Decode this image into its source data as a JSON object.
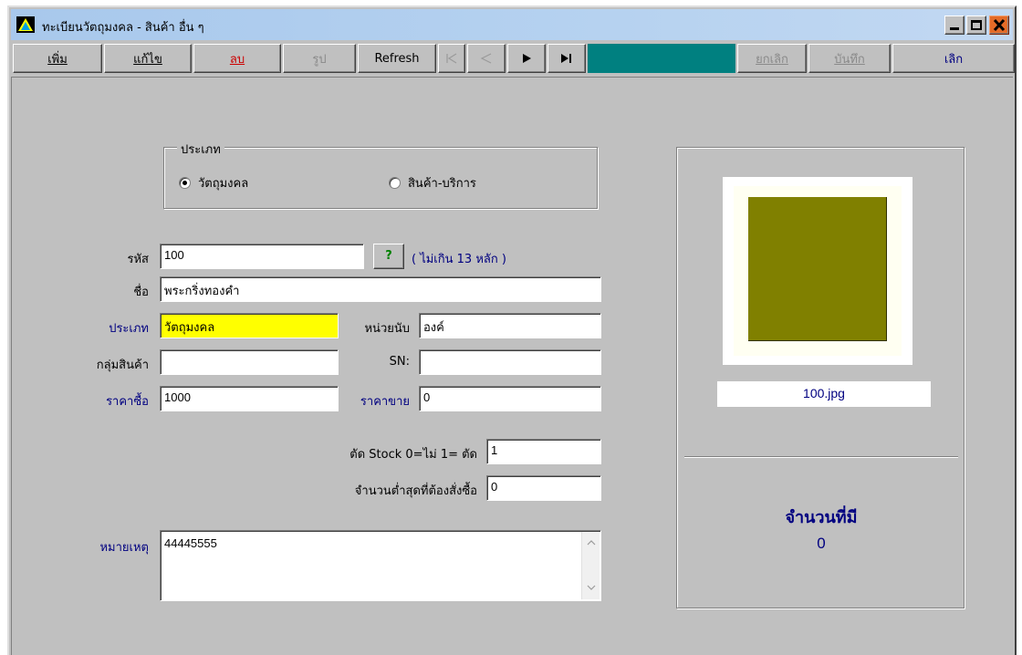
{
  "window": {
    "title": "ทะเบียนวัตถุมงคล - สินค้า อื่น ๆ"
  },
  "toolbar": {
    "add": "เพิ่ม",
    "edit": "แก้ไข",
    "delete": "ลบ",
    "image": "รูป",
    "refresh": "Refresh",
    "first": "⏮",
    "prev": "◀",
    "next": "▶",
    "last": "⏭",
    "cancel": "ยกเลิก",
    "save": "บันทึก",
    "quit": "เลิก"
  },
  "type_group": {
    "legend": "ประเภท",
    "options": [
      "วัตถุมงคล",
      "สินค้า-บริการ"
    ],
    "selected": "วัตถุมงคล"
  },
  "form": {
    "code_label": "รหัส",
    "code_value": "100",
    "lookup_button": "?",
    "code_hint": "( ไม่เกิน 13 หลัก )",
    "name_label": "ชื่อ",
    "name_value": "พระกริ่งทองคำ",
    "category_label": "ประเภท",
    "category_value": "วัตถุมงคล",
    "unit_label": "หน่วยนับ",
    "unit_value": "องค์",
    "group_label": "กลุ่มสินค้า",
    "group_value": "",
    "sn_label": "SN:",
    "sn_value": "",
    "cost_label": "ราคาซื้อ",
    "cost_value": "1000",
    "price_label": "ราคาขาย",
    "price_value": "0",
    "cut_stock_label": "ตัด Stock 0=ไม่ 1= ตัด",
    "cut_stock_value": "1",
    "min_order_label": "จำนวนต่ำสุดที่ต้องสั่งซื้อ",
    "min_order_value": "0",
    "note_label": "หมายเหตุ",
    "note_value": "44445555"
  },
  "side_panel": {
    "photo_filename": "100.jpg",
    "photo_color": "#808000",
    "qty_label": "จำนวนที่มี",
    "qty_value": "0"
  },
  "colors": {
    "accent_teal": "#008080",
    "delete_red": "#cc0000",
    "highlight_yellow": "#ffff00",
    "text_navy": "#000080"
  }
}
